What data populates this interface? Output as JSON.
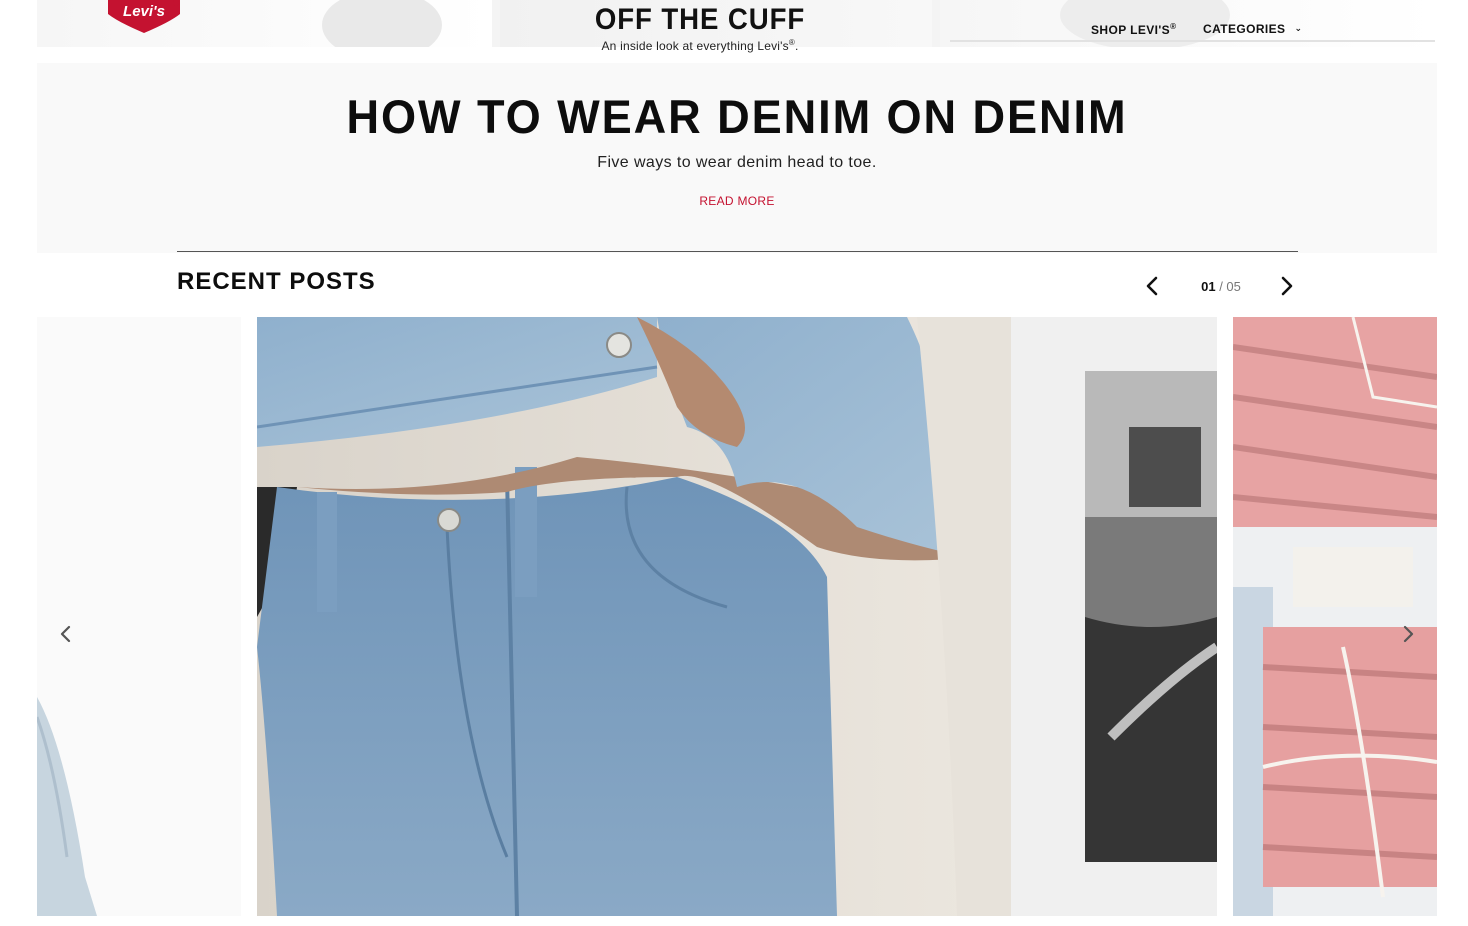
{
  "header": {
    "logo_text": "Levi's",
    "title": "OFF THE CUFF",
    "subtitle": "An inside look at everything Levi's",
    "subtitle_mark": "®",
    "subtitle_end": ".",
    "nav": {
      "shop_label": "SHOP LEVI'S",
      "shop_mark": "®",
      "categories_label": "CATEGORIES"
    }
  },
  "feature": {
    "title": "HOW TO WEAR DENIM ON DENIM",
    "subtitle": "Five ways to wear denim head to toe.",
    "cta": "READ MORE"
  },
  "recent_posts": {
    "heading": "RECENT POSTS",
    "pagination": {
      "current": "01",
      "separator": " / ",
      "total": "05"
    }
  },
  "colors": {
    "brand_red": "#c41230",
    "text_dark": "#0d0d0d",
    "panel_bg": "#f9f9f9"
  }
}
